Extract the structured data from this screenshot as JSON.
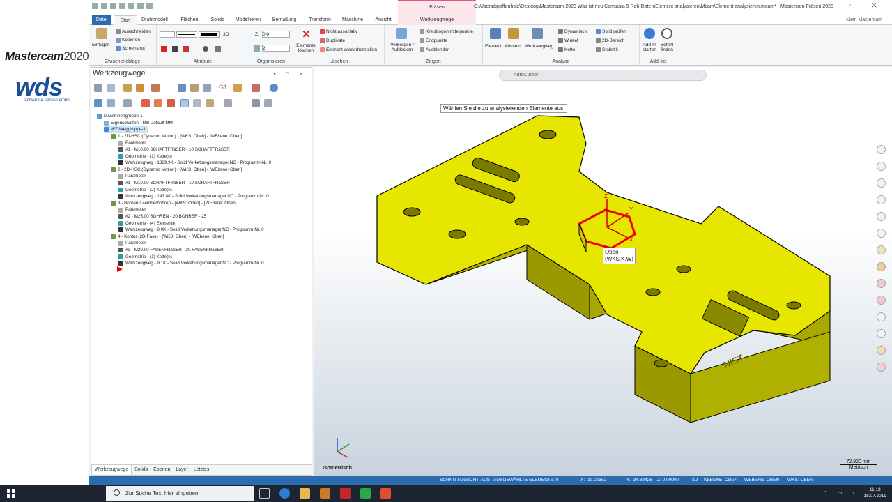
{
  "brand": {
    "mastercam": "Mastercam",
    "year": "2020",
    "wds": "wds",
    "wds_sub": "software & service gmbh"
  },
  "title": {
    "context_tab": "Fräsen",
    "window_title": "C:\\Users\\bpaffenholz\\Desktop\\Mastercam 2020 Was ist neu Camtasia 9 Roh-Daten\\Element analysieren\\Mcam\\Element analysieren.mcam* - Mastercam Fräsen 2020",
    "controls": "🗕 ▫ ✕",
    "mein": "Mein Mastercam"
  },
  "tabs": [
    "Datei",
    "Start",
    "Drahtmodell",
    "Flächen",
    "Solids",
    "Modellieren",
    "Bemaßung",
    "Transform",
    "Maschine",
    "Ansicht",
    "Werkzeugwege"
  ],
  "ribbon": {
    "clipboard": {
      "paste": "Einfügen",
      "cut": "Ausschneiden",
      "copy": "Kopieren",
      "screenshot": "Screenshot",
      "label": "Zwischenablage"
    },
    "attributes": {
      "label": "Attribute",
      "threed": "3D"
    },
    "organize": {
      "z_label": "Z:",
      "z_value": "0.0",
      "level": "2",
      "label": "Organisieren"
    },
    "delete": {
      "delete_elems": "Elemente löschen",
      "not_assoc": "Nicht assoziativ",
      "duplicates": "Duplikate",
      "restore": "Element wiederherstellen",
      "label": "Löschen"
    },
    "show": {
      "hide": "Verbergen / Aufdecken",
      "arc_centers": "Kreisbogenmittelpunkte",
      "endpoints": "Endpunkte",
      "hide_all": "Ausblenden",
      "label": "Zeigen"
    },
    "analysis": {
      "element": "Element",
      "distance": "Abstand",
      "toolpath": "Werkzeugweg",
      "dynamic": "Dynamisch",
      "angle": "Winkel",
      "chain": "Kette",
      "solid_check": "Solid prüfen",
      "area2d": "2D-Bereich",
      "statistics": "Statistik",
      "label": "Analyse"
    },
    "addins": {
      "start": "Add-In starten",
      "find": "Befehl finden",
      "label": "Add-Ins"
    }
  },
  "panel": {
    "title": "Werkzeugwege",
    "controls": "▾ ⊓ ✕",
    "tree": [
      "Maschinengruppe-1",
      "Eigenschaften - Mill Default MM",
      "WZ-Weggruppe-1",
      "1 - 2D-HSC (Dynamic Motion) - [WKS: Oben] - [WEbene: Oben]",
      "Parameter",
      "#1 - M10.00 SCHAFTFRäSER - 10 SCHAFTFRäSER",
      "Geometrie - (1) Kette(n)",
      "Werkzeugweg - 1389.9K - Solid Verkettungsmanager.NC - Programm-Nr. 0",
      "2 - 2D-HSC (Dynamic Motion) - [WKS: Oben] - [WEbene: Oben]",
      "Parameter",
      "#1 - M10.00 SCHAFTFRäSER - 10 SCHAFTFRäSER",
      "Geometrie - (2) Kette(n)",
      "Werkzeugweg - 143.8K - Solid Verkettungsmanager.NC - Programm-Nr. 0",
      "3 - Bohren / Zentrierbohren - [WKS: Oben] - [WEbene: Oben]",
      "Parameter",
      "#2 - M25.00 BOHREN - 20 BOHRER - 25",
      "Geometrie - (4) Elemente",
      "Werkzeugweg - 8.0K - Solid Verkettungsmanager.NC - Programm-Nr. 0",
      "4 - Kontur (2D-Fase) - [WKS: Oben] - [WEbene: Oben]",
      "Parameter",
      "#3 - M20.00 FASENFRäSER - 20 FASENFRäSER",
      "Geometrie - (1) Kette(n)",
      "Werkzeugweg - 9.1K - Solid Verkettungsmanager.NC - Programm-Nr. 0"
    ],
    "g1": "G1",
    "tabs": [
      "Werkzeugwege",
      "Solids",
      "Ebenen",
      "Layer",
      "Letztes"
    ]
  },
  "viewport": {
    "autocursor": "AutoCursor",
    "prompt": "Wählen Sie die zu analysierenden Elemente aus.",
    "gnomon_label_1": "Oben",
    "gnomon_label_2": "(WKS,K,W)",
    "axis_x": "X",
    "axis_y": "Y",
    "axis_z": "Z",
    "part_text": "NIST",
    "view_name": "Isometrisch",
    "scale_value": "72.920 mm",
    "scale_unit": "Metrisch"
  },
  "status": {
    "section": "SCHNITTANSICHT: AUS",
    "selected": "AUSGEWÄHLTE ELEMENTE: 0",
    "x": "X:   -10.00352",
    "y": "Y:   -34.88426",
    "z": "Z:   0.00000",
    "mode": "3D",
    "kplane": "KEBENE: OBEN",
    "wplane": "WEBENE: OBEN",
    "wcs": "WKS: OBEN"
  },
  "taskbar": {
    "search_placeholder": "Zur Suche Text hier eingeben",
    "time": "11:13",
    "date": "18.07.2019"
  },
  "colors": {
    "part_yellow": "#e6e600",
    "accent_blue": "#2b6cb0",
    "context_pink": "#fbe6ec"
  }
}
